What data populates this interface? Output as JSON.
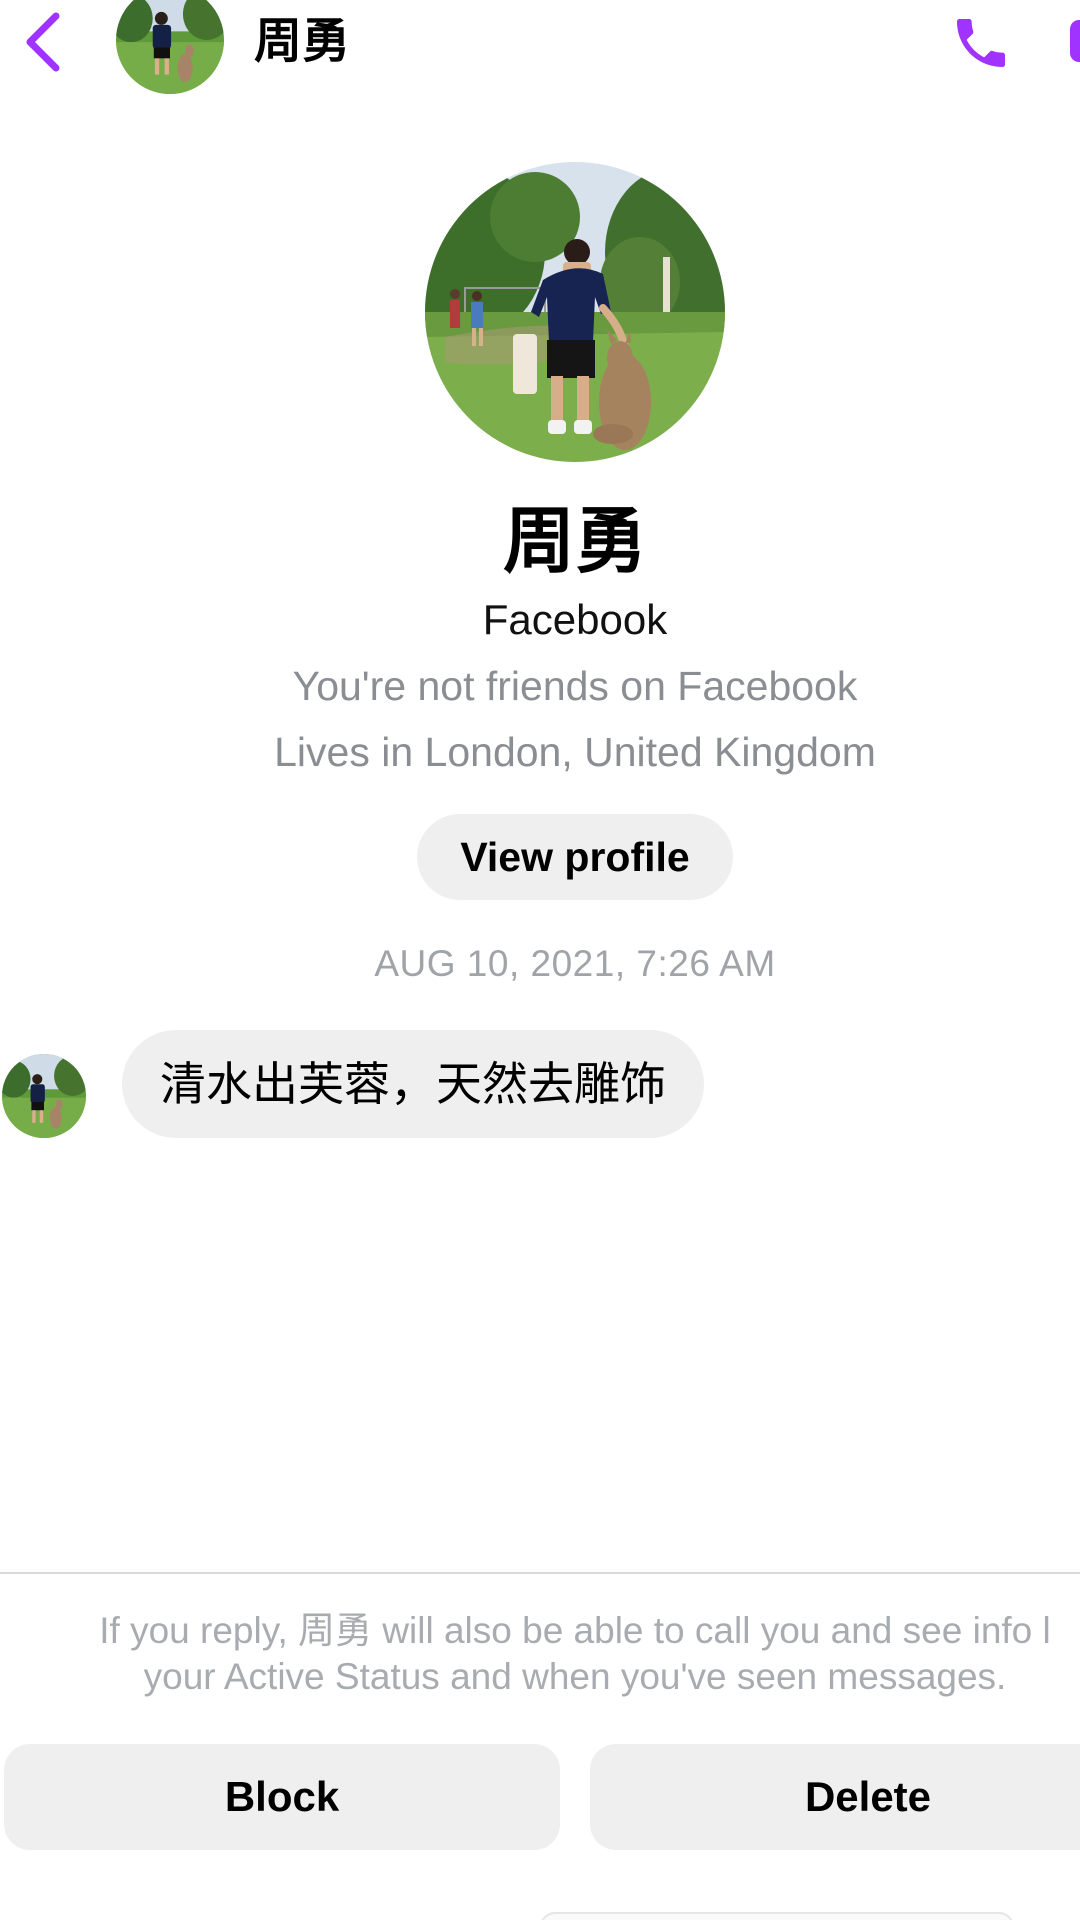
{
  "header": {
    "back_icon": "chevron-left-icon",
    "name": "周勇",
    "call_icon": "phone-icon",
    "video_icon": "video-camera-icon",
    "accent_color": "#a033ff"
  },
  "profile": {
    "name": "周勇",
    "platform": "Facebook",
    "friend_status": "You're not friends on Facebook",
    "location": "Lives in London, United Kingdom",
    "view_profile_label": "View profile"
  },
  "conversation": {
    "timestamp": "AUG 10, 2021, 7:26 AM",
    "messages": [
      {
        "text": "清水出芙蓉，天然去雕饰"
      }
    ]
  },
  "footer": {
    "notice_line1": "If you reply, 周勇 will also be able to call you and see info l",
    "notice_line2": "your Active Status and when you've seen messages.",
    "block_label": "Block",
    "delete_label": "Delete"
  }
}
